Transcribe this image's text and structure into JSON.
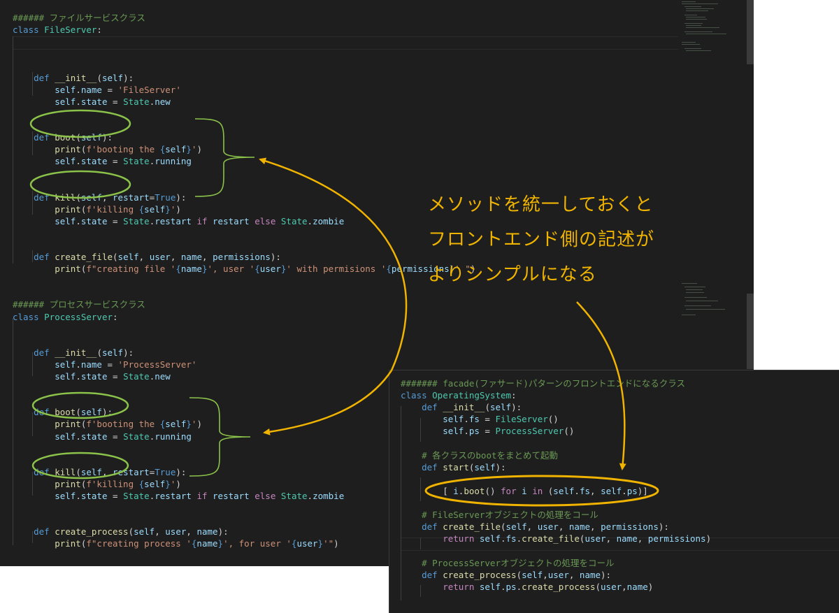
{
  "main_editor": {
    "lines": [
      [
        {
          "t": "###### ファイルサービスクラス",
          "c": "cm"
        }
      ],
      [
        {
          "t": "class ",
          "c": "kw"
        },
        {
          "t": "FileServer",
          "c": "cls"
        },
        {
          "t": ":",
          "c": ""
        }
      ],
      [],
      [],
      [],
      [
        {
          "t": "    def ",
          "c": "kw"
        },
        {
          "t": "__init__",
          "c": "fn"
        },
        {
          "t": "(",
          "c": ""
        },
        {
          "t": "self",
          "c": "var"
        },
        {
          "t": "):",
          "c": ""
        }
      ],
      [
        {
          "t": "        self",
          "c": "var"
        },
        {
          "t": ".",
          "c": ""
        },
        {
          "t": "name",
          "c": "var"
        },
        {
          "t": " = ",
          "c": ""
        },
        {
          "t": "'FileServer'",
          "c": "str"
        }
      ],
      [
        {
          "t": "        self",
          "c": "var"
        },
        {
          "t": ".",
          "c": ""
        },
        {
          "t": "state",
          "c": "var"
        },
        {
          "t": " = ",
          "c": ""
        },
        {
          "t": "State",
          "c": "cls"
        },
        {
          "t": ".",
          "c": ""
        },
        {
          "t": "new",
          "c": "var"
        }
      ],
      [],
      [],
      [
        {
          "t": "    def ",
          "c": "kw"
        },
        {
          "t": "boot",
          "c": "fn"
        },
        {
          "t": "(",
          "c": ""
        },
        {
          "t": "self",
          "c": "var"
        },
        {
          "t": "):",
          "c": ""
        }
      ],
      [
        {
          "t": "        print",
          "c": "fn"
        },
        {
          "t": "(",
          "c": ""
        },
        {
          "t": "f'booting the ",
          "c": "str"
        },
        {
          "t": "{",
          "c": "kw"
        },
        {
          "t": "self",
          "c": "var"
        },
        {
          "t": "}",
          "c": "kw"
        },
        {
          "t": "'",
          "c": "str"
        },
        {
          "t": ")",
          "c": ""
        }
      ],
      [
        {
          "t": "        self",
          "c": "var"
        },
        {
          "t": ".",
          "c": ""
        },
        {
          "t": "state",
          "c": "var"
        },
        {
          "t": " = ",
          "c": ""
        },
        {
          "t": "State",
          "c": "cls"
        },
        {
          "t": ".",
          "c": ""
        },
        {
          "t": "running",
          "c": "var"
        }
      ],
      [],
      [],
      [
        {
          "t": "    def ",
          "c": "kw"
        },
        {
          "t": "kill",
          "c": "fn"
        },
        {
          "t": "(",
          "c": ""
        },
        {
          "t": "self",
          "c": "var"
        },
        {
          "t": ", ",
          "c": ""
        },
        {
          "t": "restart",
          "c": "var"
        },
        {
          "t": "=",
          "c": ""
        },
        {
          "t": "True",
          "c": "kw"
        },
        {
          "t": "):",
          "c": ""
        }
      ],
      [
        {
          "t": "        print",
          "c": "fn"
        },
        {
          "t": "(",
          "c": ""
        },
        {
          "t": "f'killing ",
          "c": "str"
        },
        {
          "t": "{",
          "c": "kw"
        },
        {
          "t": "self",
          "c": "var"
        },
        {
          "t": "}",
          "c": "kw"
        },
        {
          "t": "'",
          "c": "str"
        },
        {
          "t": ")",
          "c": ""
        }
      ],
      [
        {
          "t": "        self",
          "c": "var"
        },
        {
          "t": ".",
          "c": ""
        },
        {
          "t": "state",
          "c": "var"
        },
        {
          "t": " = ",
          "c": ""
        },
        {
          "t": "State",
          "c": "cls"
        },
        {
          "t": ".",
          "c": ""
        },
        {
          "t": "restart ",
          "c": "var"
        },
        {
          "t": "if ",
          "c": "ctl"
        },
        {
          "t": "restart ",
          "c": "var"
        },
        {
          "t": "else ",
          "c": "ctl"
        },
        {
          "t": "State",
          "c": "cls"
        },
        {
          "t": ".",
          "c": ""
        },
        {
          "t": "zombie",
          "c": "var"
        }
      ],
      [],
      [],
      [
        {
          "t": "    def ",
          "c": "kw"
        },
        {
          "t": "create_file",
          "c": "fn"
        },
        {
          "t": "(",
          "c": ""
        },
        {
          "t": "self",
          "c": "var"
        },
        {
          "t": ", ",
          "c": ""
        },
        {
          "t": "user",
          "c": "var"
        },
        {
          "t": ", ",
          "c": ""
        },
        {
          "t": "name",
          "c": "var"
        },
        {
          "t": ", ",
          "c": ""
        },
        {
          "t": "permissions",
          "c": "var"
        },
        {
          "t": "):",
          "c": ""
        }
      ],
      [
        {
          "t": "        print",
          "c": "fn"
        },
        {
          "t": "(",
          "c": ""
        },
        {
          "t": "f\"creating file '",
          "c": "str"
        },
        {
          "t": "{",
          "c": "kw"
        },
        {
          "t": "name",
          "c": "var"
        },
        {
          "t": "}",
          "c": "kw"
        },
        {
          "t": "', user '",
          "c": "str"
        },
        {
          "t": "{",
          "c": "kw"
        },
        {
          "t": "user",
          "c": "var"
        },
        {
          "t": "}",
          "c": "kw"
        },
        {
          "t": "' with permisions '",
          "c": "str"
        },
        {
          "t": "{",
          "c": "kw"
        },
        {
          "t": "permissions",
          "c": "var"
        },
        {
          "t": "}",
          "c": "kw"
        },
        {
          "t": "' \"",
          "c": "str"
        },
        {
          "t": ")",
          "c": ""
        }
      ],
      [],
      [],
      [
        {
          "t": "###### プロセスサービスクラス",
          "c": "cm"
        }
      ],
      [
        {
          "t": "class ",
          "c": "kw"
        },
        {
          "t": "ProcessServer",
          "c": "cls"
        },
        {
          "t": ":",
          "c": ""
        }
      ],
      [],
      [],
      [
        {
          "t": "    def ",
          "c": "kw"
        },
        {
          "t": "__init__",
          "c": "fn"
        },
        {
          "t": "(",
          "c": ""
        },
        {
          "t": "self",
          "c": "var"
        },
        {
          "t": "):",
          "c": ""
        }
      ],
      [
        {
          "t": "        self",
          "c": "var"
        },
        {
          "t": ".",
          "c": ""
        },
        {
          "t": "name",
          "c": "var"
        },
        {
          "t": " = ",
          "c": ""
        },
        {
          "t": "'ProcessServer'",
          "c": "str"
        }
      ],
      [
        {
          "t": "        self",
          "c": "var"
        },
        {
          "t": ".",
          "c": ""
        },
        {
          "t": "state",
          "c": "var"
        },
        {
          "t": " = ",
          "c": ""
        },
        {
          "t": "State",
          "c": "cls"
        },
        {
          "t": ".",
          "c": ""
        },
        {
          "t": "new",
          "c": "var"
        }
      ],
      [],
      [],
      [
        {
          "t": "    def ",
          "c": "kw"
        },
        {
          "t": "boot",
          "c": "fn"
        },
        {
          "t": "(",
          "c": ""
        },
        {
          "t": "self",
          "c": "var"
        },
        {
          "t": "):",
          "c": ""
        }
      ],
      [
        {
          "t": "        print",
          "c": "fn"
        },
        {
          "t": "(",
          "c": ""
        },
        {
          "t": "f'booting the ",
          "c": "str"
        },
        {
          "t": "{",
          "c": "kw"
        },
        {
          "t": "self",
          "c": "var"
        },
        {
          "t": "}",
          "c": "kw"
        },
        {
          "t": "'",
          "c": "str"
        },
        {
          "t": ")",
          "c": ""
        }
      ],
      [
        {
          "t": "        self",
          "c": "var"
        },
        {
          "t": ".",
          "c": ""
        },
        {
          "t": "state",
          "c": "var"
        },
        {
          "t": " = ",
          "c": ""
        },
        {
          "t": "State",
          "c": "cls"
        },
        {
          "t": ".",
          "c": ""
        },
        {
          "t": "running",
          "c": "var"
        }
      ],
      [],
      [],
      [
        {
          "t": "    def ",
          "c": "kw"
        },
        {
          "t": "kill",
          "c": "fn"
        },
        {
          "t": "(",
          "c": ""
        },
        {
          "t": "self",
          "c": "var"
        },
        {
          "t": ", ",
          "c": ""
        },
        {
          "t": "restart",
          "c": "var"
        },
        {
          "t": "=",
          "c": ""
        },
        {
          "t": "True",
          "c": "kw"
        },
        {
          "t": "):",
          "c": ""
        }
      ],
      [
        {
          "t": "        print",
          "c": "fn"
        },
        {
          "t": "(",
          "c": ""
        },
        {
          "t": "f'killing ",
          "c": "str"
        },
        {
          "t": "{",
          "c": "kw"
        },
        {
          "t": "self",
          "c": "var"
        },
        {
          "t": "}",
          "c": "kw"
        },
        {
          "t": "'",
          "c": "str"
        },
        {
          "t": ")",
          "c": ""
        }
      ],
      [
        {
          "t": "        self",
          "c": "var"
        },
        {
          "t": ".",
          "c": ""
        },
        {
          "t": "state",
          "c": "var"
        },
        {
          "t": " = ",
          "c": ""
        },
        {
          "t": "State",
          "c": "cls"
        },
        {
          "t": ".",
          "c": ""
        },
        {
          "t": "restart ",
          "c": "var"
        },
        {
          "t": "if ",
          "c": "ctl"
        },
        {
          "t": "restart ",
          "c": "var"
        },
        {
          "t": "else ",
          "c": "ctl"
        },
        {
          "t": "State",
          "c": "cls"
        },
        {
          "t": ".",
          "c": ""
        },
        {
          "t": "zombie",
          "c": "var"
        }
      ],
      [],
      [],
      [
        {
          "t": "    def ",
          "c": "kw"
        },
        {
          "t": "create_process",
          "c": "fn"
        },
        {
          "t": "(",
          "c": ""
        },
        {
          "t": "self",
          "c": "var"
        },
        {
          "t": ", ",
          "c": ""
        },
        {
          "t": "user",
          "c": "var"
        },
        {
          "t": ", ",
          "c": ""
        },
        {
          "t": "name",
          "c": "var"
        },
        {
          "t": "):",
          "c": ""
        }
      ],
      [
        {
          "t": "        print",
          "c": "fn"
        },
        {
          "t": "(",
          "c": ""
        },
        {
          "t": "f\"creating process '",
          "c": "str"
        },
        {
          "t": "{",
          "c": "kw"
        },
        {
          "t": "name",
          "c": "var"
        },
        {
          "t": "}",
          "c": "kw"
        },
        {
          "t": "', for user '",
          "c": "str"
        },
        {
          "t": "{",
          "c": "kw"
        },
        {
          "t": "user",
          "c": "var"
        },
        {
          "t": "}",
          "c": "kw"
        },
        {
          "t": "'\"",
          "c": "str"
        },
        {
          "t": ")",
          "c": ""
        }
      ]
    ]
  },
  "facade_editor": {
    "lines": [
      [
        {
          "t": "####### facade(ファサード)パターンのフロントエンドになるクラス",
          "c": "cm"
        }
      ],
      [
        {
          "t": "class ",
          "c": "kw"
        },
        {
          "t": "OperatingSystem",
          "c": "cls"
        },
        {
          "t": ":",
          "c": ""
        }
      ],
      [
        {
          "t": "    def ",
          "c": "kw"
        },
        {
          "t": "__init__",
          "c": "fn"
        },
        {
          "t": "(",
          "c": ""
        },
        {
          "t": "self",
          "c": "var"
        },
        {
          "t": "):",
          "c": ""
        }
      ],
      [
        {
          "t": "        self",
          "c": "var"
        },
        {
          "t": ".",
          "c": ""
        },
        {
          "t": "fs",
          "c": "var"
        },
        {
          "t": " = ",
          "c": ""
        },
        {
          "t": "FileServer",
          "c": "cls"
        },
        {
          "t": "()",
          "c": ""
        }
      ],
      [
        {
          "t": "        self",
          "c": "var"
        },
        {
          "t": ".",
          "c": ""
        },
        {
          "t": "ps",
          "c": "var"
        },
        {
          "t": " = ",
          "c": ""
        },
        {
          "t": "ProcessServer",
          "c": "cls"
        },
        {
          "t": "()",
          "c": ""
        }
      ],
      [],
      [
        {
          "t": "    # 各クラスのbootをまとめて起動",
          "c": "cm"
        }
      ],
      [
        {
          "t": "    def ",
          "c": "kw"
        },
        {
          "t": "start",
          "c": "fn"
        },
        {
          "t": "(",
          "c": ""
        },
        {
          "t": "self",
          "c": "var"
        },
        {
          "t": "):",
          "c": ""
        }
      ],
      [],
      [
        {
          "t": "        [ ",
          "c": ""
        },
        {
          "t": "i",
          "c": "var"
        },
        {
          "t": ".",
          "c": ""
        },
        {
          "t": "boot",
          "c": "fn"
        },
        {
          "t": "() ",
          "c": ""
        },
        {
          "t": "for ",
          "c": "ctl"
        },
        {
          "t": "i ",
          "c": "var"
        },
        {
          "t": "in ",
          "c": "ctl"
        },
        {
          "t": "(",
          "c": ""
        },
        {
          "t": "self",
          "c": "var"
        },
        {
          "t": ".",
          "c": ""
        },
        {
          "t": "fs",
          "c": "var"
        },
        {
          "t": ", ",
          "c": ""
        },
        {
          "t": "self",
          "c": "var"
        },
        {
          "t": ".",
          "c": ""
        },
        {
          "t": "ps",
          "c": "var"
        },
        {
          "t": ")]",
          "c": ""
        }
      ],
      [],
      [
        {
          "t": "    # FileServerオブジェクトの処理をコール",
          "c": "cm"
        }
      ],
      [
        {
          "t": "    def ",
          "c": "kw"
        },
        {
          "t": "create_file",
          "c": "fn"
        },
        {
          "t": "(",
          "c": ""
        },
        {
          "t": "self",
          "c": "var"
        },
        {
          "t": ", ",
          "c": ""
        },
        {
          "t": "user",
          "c": "var"
        },
        {
          "t": ", ",
          "c": ""
        },
        {
          "t": "name",
          "c": "var"
        },
        {
          "t": ", ",
          "c": ""
        },
        {
          "t": "permissions",
          "c": "var"
        },
        {
          "t": "):",
          "c": ""
        }
      ],
      [
        {
          "t": "        return ",
          "c": "ctl"
        },
        {
          "t": "self",
          "c": "var"
        },
        {
          "t": ".",
          "c": ""
        },
        {
          "t": "fs",
          "c": "var"
        },
        {
          "t": ".",
          "c": ""
        },
        {
          "t": "create_file",
          "c": "fn"
        },
        {
          "t": "(",
          "c": ""
        },
        {
          "t": "user",
          "c": "var"
        },
        {
          "t": ", ",
          "c": ""
        },
        {
          "t": "name",
          "c": "var"
        },
        {
          "t": ", ",
          "c": ""
        },
        {
          "t": "permissions",
          "c": "var"
        },
        {
          "t": ")",
          "c": ""
        }
      ],
      [],
      [
        {
          "t": "    # ProcessServerオブジェクトの処理をコール",
          "c": "cm"
        }
      ],
      [
        {
          "t": "    def ",
          "c": "kw"
        },
        {
          "t": "create_process",
          "c": "fn"
        },
        {
          "t": "(",
          "c": ""
        },
        {
          "t": "self",
          "c": "var"
        },
        {
          "t": ",",
          "c": ""
        },
        {
          "t": "user",
          "c": "var"
        },
        {
          "t": ", ",
          "c": ""
        },
        {
          "t": "name",
          "c": "var"
        },
        {
          "t": "):",
          "c": ""
        }
      ],
      [
        {
          "t": "        return ",
          "c": "ctl"
        },
        {
          "t": "self",
          "c": "var"
        },
        {
          "t": ".",
          "c": ""
        },
        {
          "t": "ps",
          "c": "var"
        },
        {
          "t": ".",
          "c": ""
        },
        {
          "t": "create_process",
          "c": "fn"
        },
        {
          "t": "(",
          "c": ""
        },
        {
          "t": "user",
          "c": "var"
        },
        {
          "t": ",",
          "c": ""
        },
        {
          "t": "name",
          "c": "var"
        },
        {
          "t": ")",
          "c": ""
        }
      ]
    ]
  },
  "callout": {
    "line1": "メソッドを統一しておくと",
    "line2": "フロントエンド側の記述が",
    "line3": "よりシンプルになる"
  },
  "colors": {
    "annotation_green": "#8bc34a",
    "annotation_orange": "#f0b400",
    "editor_background": "#1e1e1e"
  }
}
